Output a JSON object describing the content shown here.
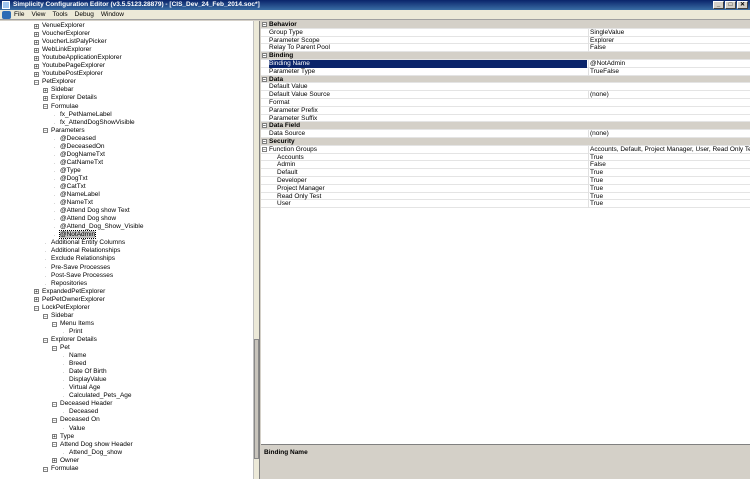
{
  "window": {
    "title": "Simplicity Configuration Editor (v3.5.5123.28879) - [CIS_Dev_24_Feb_2014.soc*]",
    "min_glyph": "_",
    "max_glyph": "□",
    "close_glyph": "✕"
  },
  "menu": [
    "File",
    "View",
    "Tools",
    "Debug",
    "Window"
  ],
  "tree": [
    {
      "label": "VenueExplorer",
      "level": 1,
      "exp": "+"
    },
    {
      "label": "VoucherExplorer",
      "level": 1,
      "exp": "+"
    },
    {
      "label": "VoucherListPalyPicker",
      "level": 1,
      "exp": "+"
    },
    {
      "label": "WebLinkExplorer",
      "level": 1,
      "exp": "+"
    },
    {
      "label": "YoutubeApplicationExplorer",
      "level": 1,
      "exp": "+"
    },
    {
      "label": "YoutubePageExplorer",
      "level": 1,
      "exp": "+"
    },
    {
      "label": "YoutubePostExplorer",
      "level": 1,
      "exp": "+"
    },
    {
      "label": "PetExplorer",
      "level": 1,
      "exp": "-"
    },
    {
      "label": "Sidebar",
      "level": 2,
      "exp": "+"
    },
    {
      "label": "Explorer Details",
      "level": 2,
      "exp": "+"
    },
    {
      "label": "Formulae",
      "level": 2,
      "exp": "-"
    },
    {
      "label": "fx_PetNameLabel",
      "level": 3,
      "exp": ""
    },
    {
      "label": "fx_AttendDogShowVisible",
      "level": 3,
      "exp": ""
    },
    {
      "label": "Parameters",
      "level": 2,
      "exp": "-"
    },
    {
      "label": "@Deceased",
      "level": 3,
      "exp": ""
    },
    {
      "label": "@DeceasedOn",
      "level": 3,
      "exp": ""
    },
    {
      "label": "@DogNameTxt",
      "level": 3,
      "exp": ""
    },
    {
      "label": "@CatNameTxt",
      "level": 3,
      "exp": ""
    },
    {
      "label": "@Type",
      "level": 3,
      "exp": ""
    },
    {
      "label": "@DogTxt",
      "level": 3,
      "exp": ""
    },
    {
      "label": "@CatTxt",
      "level": 3,
      "exp": ""
    },
    {
      "label": "@NameLabel",
      "level": 3,
      "exp": ""
    },
    {
      "label": "@NameTxt",
      "level": 3,
      "exp": ""
    },
    {
      "label": "@Attend Dog show Text",
      "level": 3,
      "exp": ""
    },
    {
      "label": "@Attend Dog show",
      "level": 3,
      "exp": ""
    },
    {
      "label": "@Attend_Dog_Show_Visible",
      "level": 3,
      "exp": ""
    },
    {
      "label": "@NotAdmin",
      "level": 3,
      "exp": "",
      "selected": true
    },
    {
      "label": "Additional Entity Columns",
      "level": 2,
      "exp": ""
    },
    {
      "label": "Additional Relationships",
      "level": 2,
      "exp": ""
    },
    {
      "label": "Exclude Relationships",
      "level": 2,
      "exp": ""
    },
    {
      "label": "Pre-Save Processes",
      "level": 2,
      "exp": ""
    },
    {
      "label": "Post-Save Processes",
      "level": 2,
      "exp": ""
    },
    {
      "label": "Repositories",
      "level": 2,
      "exp": ""
    },
    {
      "label": "ExpandedPetExplorer",
      "level": 1,
      "exp": "+"
    },
    {
      "label": "PetPetOwnerExplorer",
      "level": 1,
      "exp": "+"
    },
    {
      "label": "LockPetExplorer",
      "level": 1,
      "exp": "-"
    },
    {
      "label": "Sidebar",
      "level": 2,
      "exp": "-"
    },
    {
      "label": "Menu Items",
      "level": 3,
      "exp": "-"
    },
    {
      "label": "Print",
      "level": 4,
      "exp": ""
    },
    {
      "label": "Explorer Details",
      "level": 2,
      "exp": "-"
    },
    {
      "label": "Pet",
      "level": 3,
      "exp": "-"
    },
    {
      "label": "Name",
      "level": 4,
      "exp": ""
    },
    {
      "label": "Breed",
      "level": 4,
      "exp": ""
    },
    {
      "label": "Date Of Birth",
      "level": 4,
      "exp": ""
    },
    {
      "label": "DisplayValue",
      "level": 4,
      "exp": ""
    },
    {
      "label": "Virtual Age",
      "level": 4,
      "exp": ""
    },
    {
      "label": "Calculated_Pets_Age",
      "level": 4,
      "exp": ""
    },
    {
      "label": "Deceased Header",
      "level": 3,
      "exp": "-"
    },
    {
      "label": "Deceased",
      "level": 4,
      "exp": ""
    },
    {
      "label": "Deceased On",
      "level": 3,
      "exp": "-"
    },
    {
      "label": "Value",
      "level": 4,
      "exp": ""
    },
    {
      "label": "Type",
      "level": 3,
      "exp": "+"
    },
    {
      "label": "Attend Dog show Header",
      "level": 3,
      "exp": "-"
    },
    {
      "label": "Attend_Dog_show",
      "level": 4,
      "exp": ""
    },
    {
      "label": "Owner",
      "level": 3,
      "exp": "+"
    },
    {
      "label": "Formulae",
      "level": 2,
      "exp": "-"
    }
  ],
  "properties": [
    {
      "section": true,
      "name": "Behavior"
    },
    {
      "name": "Group Type",
      "value": "SingleValue"
    },
    {
      "name": "Parameter Scope",
      "value": "Explorer"
    },
    {
      "name": "Relay To Parent Pool",
      "value": "False"
    },
    {
      "section": true,
      "name": "Binding"
    },
    {
      "name": "Binding Name",
      "value": "@NotAdmin",
      "selected": true
    },
    {
      "name": "Parameter Type",
      "value": "TrueFalse"
    },
    {
      "section": true,
      "name": "Data"
    },
    {
      "name": "Default Value",
      "value": ""
    },
    {
      "name": "Default Value Source",
      "value": "(none)"
    },
    {
      "name": "Format",
      "value": ""
    },
    {
      "name": "Parameter Prefix",
      "value": ""
    },
    {
      "name": "Parameter Suffix",
      "value": ""
    },
    {
      "section": true,
      "name": "Data Field"
    },
    {
      "name": "Data Source",
      "value": "(none)"
    },
    {
      "section": true,
      "name": "Security"
    },
    {
      "name": "Function Groups",
      "value": "Accounts, Default, Project Manager, User, Read Only Test, Developer",
      "expand": true
    },
    {
      "name": "Accounts",
      "value": "True",
      "indent": true
    },
    {
      "name": "Admin",
      "value": "False",
      "indent": true
    },
    {
      "name": "Default",
      "value": "True",
      "indent": true
    },
    {
      "name": "Developer",
      "value": "True",
      "indent": true
    },
    {
      "name": "Project Manager",
      "value": "True",
      "indent": true
    },
    {
      "name": "Read Only Test",
      "value": "True",
      "indent": true
    },
    {
      "name": "User",
      "value": "True",
      "indent": true
    }
  ],
  "description": {
    "title": "Binding Name"
  }
}
